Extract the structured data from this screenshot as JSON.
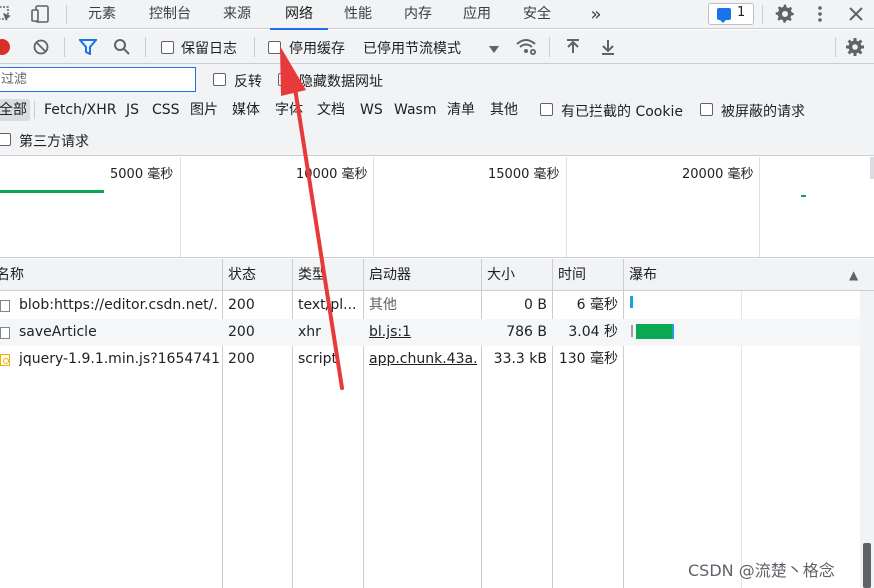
{
  "tabs": [
    {
      "label": "元素"
    },
    {
      "label": "控制台"
    },
    {
      "label": "来源"
    },
    {
      "label": "网络",
      "active": true
    },
    {
      "label": "性能"
    },
    {
      "label": "内存"
    },
    {
      "label": "应用"
    },
    {
      "label": "安全"
    }
  ],
  "more_tabs": "»",
  "issues_badge": {
    "count": "1",
    "color": "#1a73e8"
  },
  "toolbar": {
    "preserve_log": "保留日志",
    "disable_cache": "停用缓存",
    "throttling": "已停用节流模式"
  },
  "filter": {
    "placeholder": "过滤",
    "value": "",
    "invert": "反转",
    "hide_data_urls": "隐藏数据网址",
    "types": [
      "全部",
      "Fetch/XHR",
      "JS",
      "CSS",
      "图片",
      "媒体",
      "字体",
      "文档",
      "WS",
      "Wasm",
      "清单",
      "其他"
    ],
    "blocked_cookies": "有已拦截的 Cookie",
    "blocked_requests": "被屏蔽的请求",
    "third_party": "第三方请求"
  },
  "overview": {
    "ticks": [
      "5000 毫秒",
      "10000 毫秒",
      "15000 毫秒",
      "20000 毫秒"
    ]
  },
  "table": {
    "headers": [
      "名称",
      "状态",
      "类型",
      "启动器",
      "大小",
      "时间",
      "瀑布"
    ],
    "sort_indicator": "▲",
    "rows": [
      {
        "name": "blob:https://editor.csdn.net/...",
        "status": "200",
        "type": "text/pl...",
        "initiator": "其他",
        "size": "0 B",
        "time": "6 毫秒"
      },
      {
        "name": "saveArticle",
        "status": "200",
        "type": "xhr",
        "initiator": "bl.js:1",
        "size": "786 B",
        "time": "3.04 秒"
      },
      {
        "name": "jquery-1.9.1.min.js?1654741...",
        "status": "200",
        "type": "script",
        "initiator": "app.chunk.43a...",
        "size": "33.3 kB",
        "time": "130 毫秒"
      }
    ]
  },
  "watermark": "CSDN @流楚丶格念",
  "colors": {
    "accent": "#1a73e8",
    "record": "#d93025",
    "annotation_arrow": "#e83a3a",
    "waterfall_green": "#0aa852"
  }
}
